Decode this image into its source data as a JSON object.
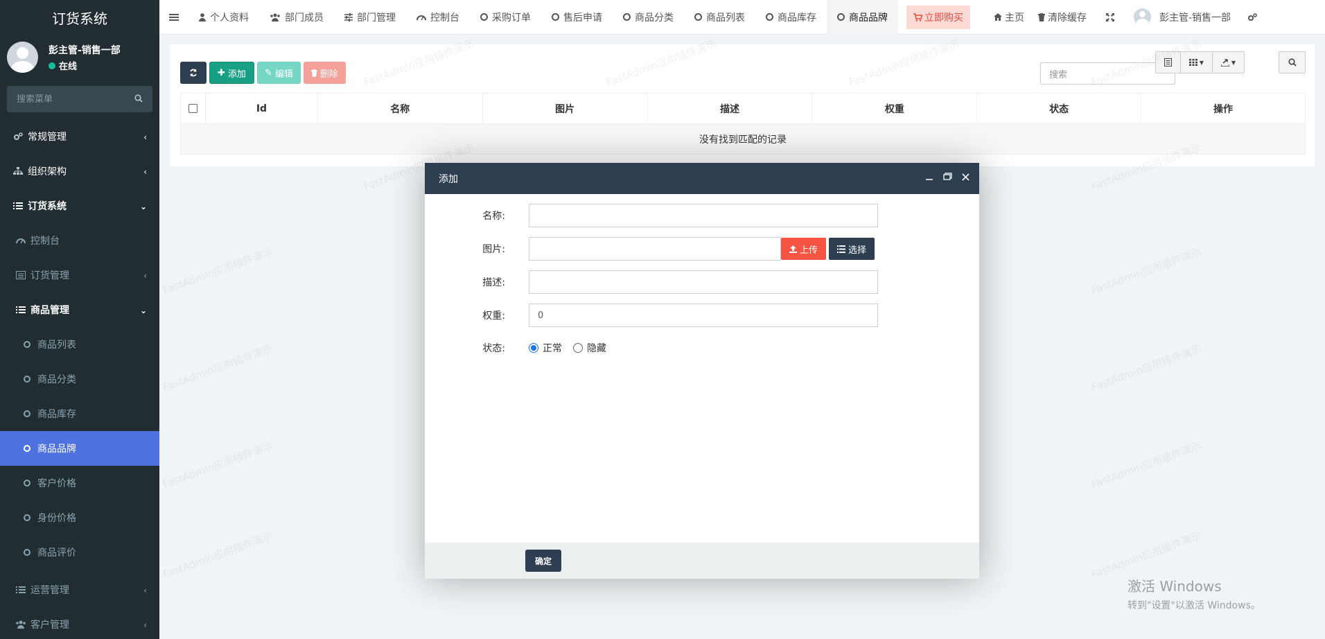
{
  "sidebar": {
    "title": "订货系统",
    "user": {
      "name": "彭主管-销售一部",
      "status": "在线"
    },
    "search_placeholder": "搜索菜单",
    "items": [
      {
        "label": "常规管理",
        "icon": "cogs-icon",
        "arrow": "‹"
      },
      {
        "label": "组织架构",
        "icon": "sitemap-icon",
        "arrow": "‹"
      },
      {
        "label": "订货系统",
        "icon": "list-icon",
        "arrow": "⌄"
      },
      {
        "label": "控制台",
        "icon": "dashboard-icon"
      },
      {
        "label": "订货管理",
        "icon": "list-alt-icon",
        "arrow": "‹"
      },
      {
        "label": "商品管理",
        "icon": "list-icon",
        "arrow": "⌄"
      },
      {
        "label": "商品列表",
        "icon": "circle-o-icon"
      },
      {
        "label": "商品分类",
        "icon": "circle-o-icon"
      },
      {
        "label": "商品库存",
        "icon": "circle-o-icon"
      },
      {
        "label": "商品品牌",
        "icon": "circle-o-icon"
      },
      {
        "label": "客户价格",
        "icon": "circle-o-icon"
      },
      {
        "label": "身份价格",
        "icon": "circle-o-icon"
      },
      {
        "label": "商品评价",
        "icon": "circle-o-icon"
      },
      {
        "label": "运营管理",
        "icon": "list-icon",
        "arrow": "‹"
      },
      {
        "label": "客户管理",
        "icon": "users-icon",
        "arrow": "‹"
      }
    ]
  },
  "topnav": {
    "tabs": [
      {
        "label": "个人资料",
        "icon": "user-icon"
      },
      {
        "label": "部门成员",
        "icon": "users-icon"
      },
      {
        "label": "部门管理",
        "icon": "sliders-icon"
      },
      {
        "label": "控制台",
        "icon": "dashboard-icon"
      },
      {
        "label": "采购订单",
        "icon": "circle-o-icon"
      },
      {
        "label": "售后申请",
        "icon": "circle-o-icon"
      },
      {
        "label": "商品分类",
        "icon": "circle-o-icon"
      },
      {
        "label": "商品列表",
        "icon": "circle-o-icon"
      },
      {
        "label": "商品库存",
        "icon": "circle-o-icon"
      },
      {
        "label": "商品品牌",
        "icon": "circle-o-icon"
      }
    ],
    "buy_label": "立即购买",
    "home_label": "主页",
    "clear_cache_label": "清除缓存",
    "user_name": "彭主管-销售一部"
  },
  "toolbar": {
    "add_label": "添加",
    "edit_label": "编辑",
    "delete_label": "删除",
    "search_placeholder": "搜索"
  },
  "table": {
    "columns": [
      "Id",
      "名称",
      "图片",
      "描述",
      "权重",
      "状态",
      "操作"
    ],
    "empty_text": "没有找到匹配的记录"
  },
  "modal": {
    "title": "添加",
    "fields": {
      "name_label": "名称:",
      "image_label": "图片:",
      "desc_label": "描述:",
      "weight_label": "权重:",
      "weight_value": "0",
      "status_label": "状态:",
      "status_normal": "正常",
      "status_hidden": "隐藏"
    },
    "upload_label": "上传",
    "select_label": "选择",
    "confirm_label": "确定"
  },
  "watermark": "FastAdmin应用插件演示",
  "windows": {
    "line1": "激活 Windows",
    "line2": "转到\"设置\"以激活 Windows。"
  },
  "colors": {
    "sidebar_bg": "#222d32",
    "active_item": "#4e73df",
    "primary_dark": "#2c3e50",
    "success": "#18a085",
    "danger": "#f75444"
  }
}
